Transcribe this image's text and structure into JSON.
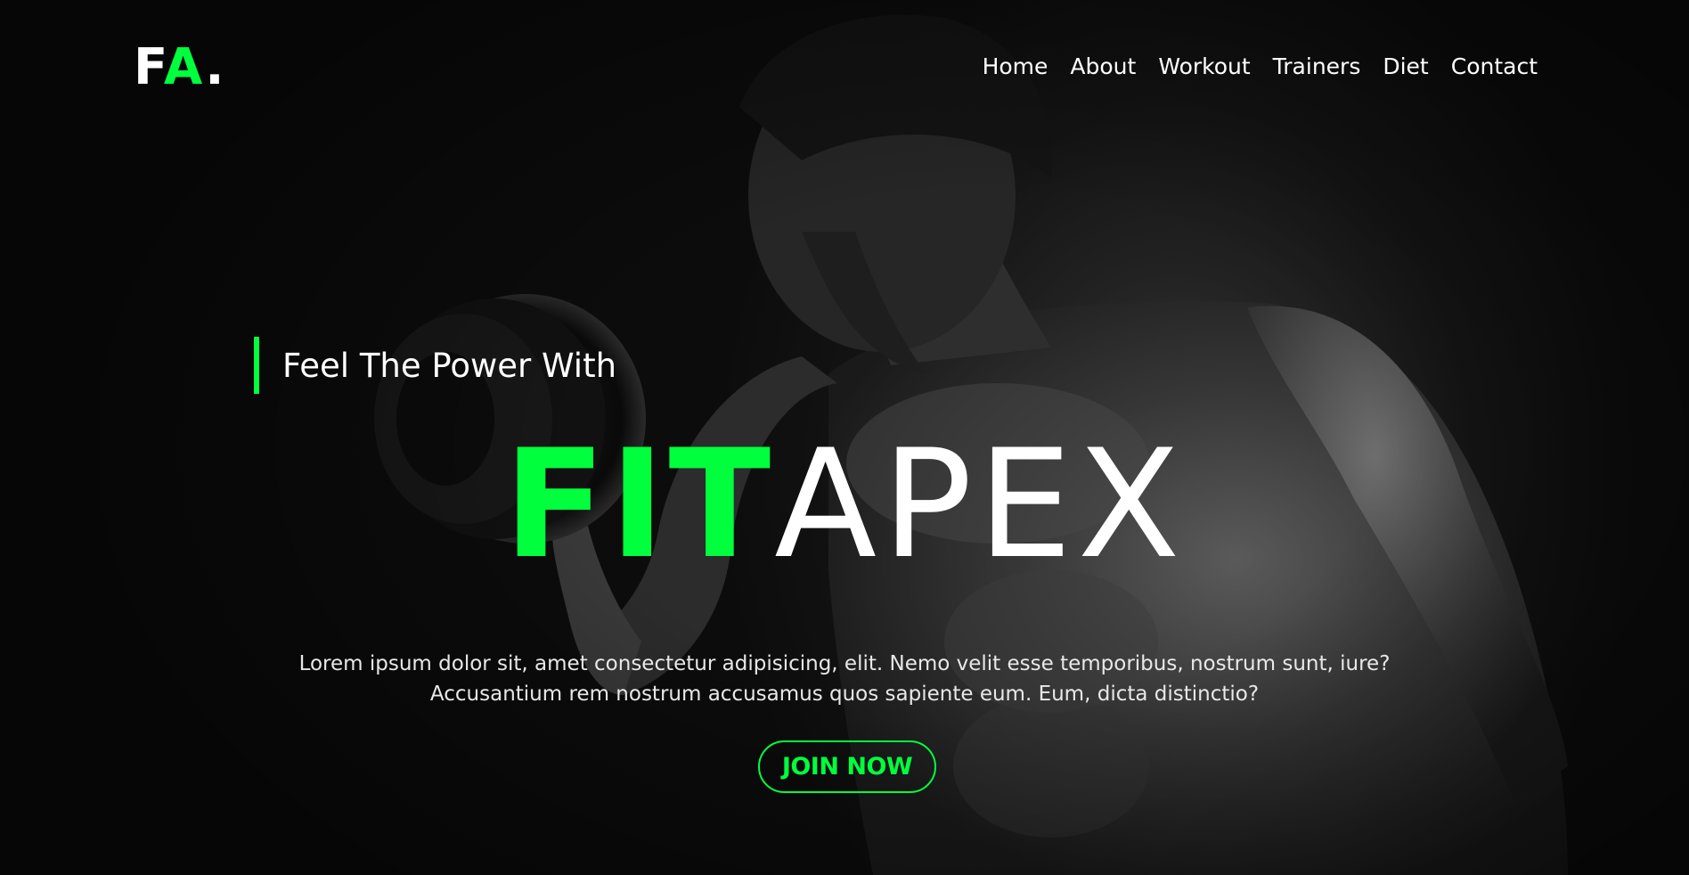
{
  "brand": {
    "logo_part1": "F",
    "logo_part2": "A",
    "logo_part3": "."
  },
  "nav": {
    "items": [
      {
        "label": "Home"
      },
      {
        "label": "About"
      },
      {
        "label": "Workout"
      },
      {
        "label": "Trainers"
      },
      {
        "label": "Diet"
      },
      {
        "label": "Contact"
      }
    ]
  },
  "hero": {
    "tagline": "Feel The Power With",
    "headline_part1": "FIT",
    "headline_part2": "APEX",
    "description_line1": "Lorem ipsum dolor sit, amet consectetur adipisicing, elit. Nemo velit esse temporibus, nostrum sunt, iure?",
    "description_line2": "Accusantium rem nostrum accusamus quos sapiente eum. Eum, dicta distinctio?",
    "cta_label": "JOIN NOW"
  },
  "colors": {
    "accent": "#00ff3c",
    "background": "#0d0d0d",
    "text": "#ffffff"
  },
  "background_image": {
    "subject": "bodybuilder-with-dumbbell-icon"
  }
}
